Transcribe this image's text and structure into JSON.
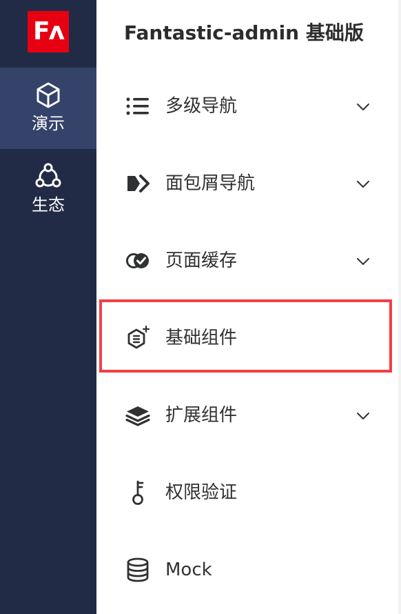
{
  "logo": {
    "text": "Fʌ",
    "color": "#e60012"
  },
  "rail": {
    "background": "#222b45",
    "active_background": "#354269",
    "items": [
      {
        "label": "演示",
        "icon": "cube-icon",
        "active": true
      },
      {
        "label": "生态",
        "icon": "ecosystem-icon",
        "active": false
      }
    ]
  },
  "header": {
    "title": "Fantastic-admin 基础版"
  },
  "menu": {
    "items": [
      {
        "label": "多级导航",
        "icon": "list-icon",
        "has_children": true
      },
      {
        "label": "面包屑导航",
        "icon": "breadcrumb-icon",
        "has_children": true
      },
      {
        "label": "页面缓存",
        "icon": "cache-toggle-icon",
        "has_children": true
      },
      {
        "label": "基础组件",
        "icon": "component-add-icon",
        "has_children": false,
        "highlighted": true
      },
      {
        "label": "扩展组件",
        "icon": "layers-icon",
        "has_children": true
      },
      {
        "label": "权限验证",
        "icon": "key-icon",
        "has_children": false
      },
      {
        "label": "Mock",
        "icon": "database-icon",
        "has_children": false
      }
    ]
  },
  "highlight_color": "#f23f44"
}
